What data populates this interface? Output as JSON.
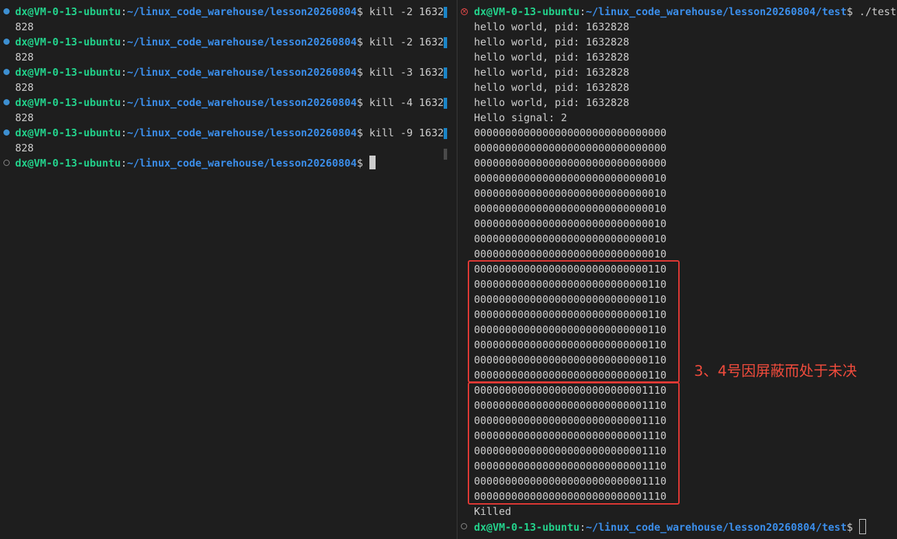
{
  "prompt": {
    "user_host": "dx@VM-0-13-ubuntu",
    "colon": ":",
    "left_path": "~/linux_code_warehouse/lesson20260804",
    "right_path": "~/linux_code_warehouse/lesson20260804/test",
    "dollar": "$"
  },
  "left_terminal": {
    "commands": [
      {
        "cmd": " kill -2 1632",
        "wrap": "828"
      },
      {
        "cmd": " kill -2 1632",
        "wrap": "828"
      },
      {
        "cmd": " kill -3 1632",
        "wrap": "828"
      },
      {
        "cmd": " kill -4 1632",
        "wrap": "828"
      },
      {
        "cmd": " kill -9 1632",
        "wrap": "828"
      }
    ]
  },
  "right_terminal": {
    "command": " ./test",
    "hello_lines": [
      "hello world, pid: 1632828",
      "hello world, pid: 1632828",
      "hello world, pid: 1632828",
      "hello world, pid: 1632828",
      "hello world, pid: 1632828",
      "hello world, pid: 1632828"
    ],
    "signal_line": "Hello signal: 2",
    "pending_lines": [
      "0000000000000000000000000000000",
      "0000000000000000000000000000000",
      "0000000000000000000000000000000",
      "0000000000000000000000000000010",
      "0000000000000000000000000000010",
      "0000000000000000000000000000010",
      "0000000000000000000000000000010",
      "0000000000000000000000000000010",
      "0000000000000000000000000000010",
      "0000000000000000000000000000110",
      "0000000000000000000000000000110",
      "0000000000000000000000000000110",
      "0000000000000000000000000000110",
      "0000000000000000000000000000110",
      "0000000000000000000000000000110",
      "0000000000000000000000000000110",
      "0000000000000000000000000000110",
      "0000000000000000000000000001110",
      "0000000000000000000000000001110",
      "0000000000000000000000000001110",
      "0000000000000000000000000001110",
      "0000000000000000000000000001110",
      "0000000000000000000000000001110",
      "0000000000000000000000000001110",
      "0000000000000000000000000001110"
    ],
    "killed_line": "Killed"
  },
  "annotation": "3、4号因屏蔽而处于未决",
  "colors": {
    "background": "#1e1e1e",
    "user_host": "#23d18b",
    "path": "#3b8eea",
    "text": "#cccccc",
    "annotation_red": "#e53935"
  }
}
